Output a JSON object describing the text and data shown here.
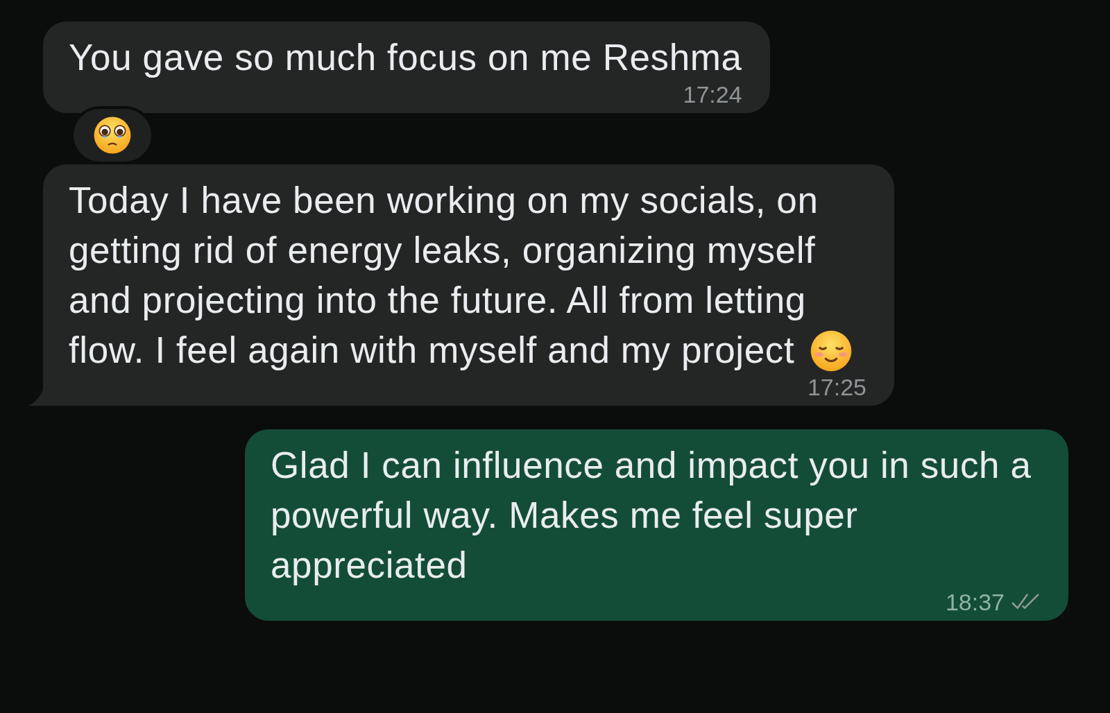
{
  "messages": [
    {
      "sent": false,
      "text": "You gave so much focus on me Reshma",
      "time": "17:24",
      "reaction": true,
      "trailing_emoji": false
    },
    {
      "sent": false,
      "text": "Today I have been working on my socials, on getting rid of energy leaks, organizing myself and projecting into the future. All from letting flow. I feel again with myself and my project",
      "time": "17:25",
      "reaction": false,
      "trailing_emoji": true
    },
    {
      "sent": true,
      "text": "Glad I can influence and impact you in such a powerful way. Makes me feel super appreciated",
      "time": "18:37",
      "reaction": false,
      "trailing_emoji": false,
      "read": false
    }
  ]
}
